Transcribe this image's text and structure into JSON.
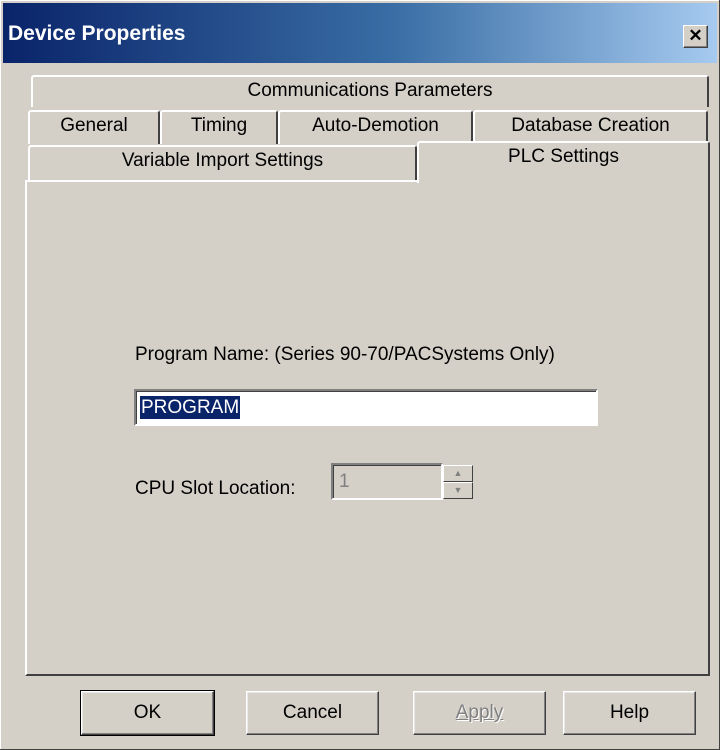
{
  "window": {
    "title": "Device Properties",
    "close_symbol": "✕"
  },
  "tabs": {
    "row1": [
      {
        "label": "Communications Parameters"
      }
    ],
    "row2": [
      {
        "label": "General"
      },
      {
        "label": "Timing"
      },
      {
        "label": "Auto-Demotion"
      },
      {
        "label": "Database Creation"
      }
    ],
    "row3": [
      {
        "label": "Variable Import Settings",
        "selected": false
      },
      {
        "label": "PLC Settings",
        "selected": true
      }
    ]
  },
  "plc_settings": {
    "program_name_label": "Program Name: (Series 90-70/PACSystems Only)",
    "program_name_value": "PROGRAM",
    "cpu_slot_label": "CPU Slot Location:",
    "cpu_slot_value": "1",
    "cpu_slot_enabled": false
  },
  "buttons": {
    "ok": "OK",
    "cancel": "Cancel",
    "apply": "Apply",
    "apply_enabled": false,
    "help": "Help"
  }
}
